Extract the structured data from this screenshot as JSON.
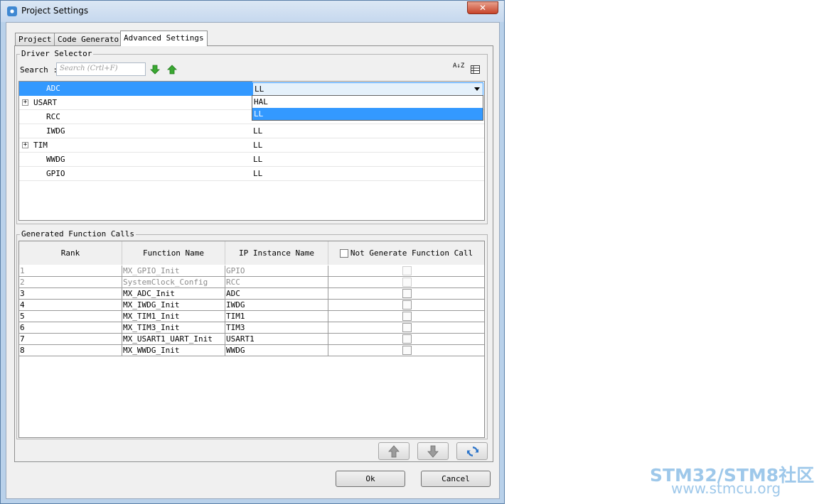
{
  "window": {
    "title": "Project Settings",
    "close_label": "✕"
  },
  "tabs": [
    {
      "label": "Project",
      "active": false
    },
    {
      "label": "Code Generator",
      "active": false
    },
    {
      "label": "Advanced Settings",
      "active": true
    }
  ],
  "driver_selector": {
    "legend": "Driver Selector",
    "search_label": "Search :",
    "search_placeholder": "Search (Crtl+F)",
    "rows": [
      {
        "name": "ADC",
        "value": "LL",
        "expandable": false,
        "selected": true
      },
      {
        "name": "USART",
        "value": "",
        "expandable": true,
        "selected": false
      },
      {
        "name": "RCC",
        "value": "",
        "expandable": false,
        "selected": false
      },
      {
        "name": "IWDG",
        "value": "LL",
        "expandable": false,
        "selected": false
      },
      {
        "name": "TIM",
        "value": "LL",
        "expandable": true,
        "selected": false
      },
      {
        "name": "WWDG",
        "value": "LL",
        "expandable": false,
        "selected": false
      },
      {
        "name": "GPIO",
        "value": "LL",
        "expandable": false,
        "selected": false
      }
    ],
    "dropdown_options": [
      "HAL",
      "LL"
    ],
    "dropdown_selected": "LL",
    "expand_glyph": "+",
    "sort_glyph": "A↓Z"
  },
  "function_calls": {
    "legend": "Generated Function Calls",
    "columns": [
      "Rank",
      "Function Name",
      "IP Instance Name",
      "Not Generate Function Call"
    ],
    "rows": [
      {
        "rank": "1",
        "function": "MX_GPIO_Init",
        "instance": "GPIO",
        "disabled": true
      },
      {
        "rank": "2",
        "function": "SystemClock_Config",
        "instance": "RCC",
        "disabled": true
      },
      {
        "rank": "3",
        "function": "MX_ADC_Init",
        "instance": "ADC",
        "disabled": false
      },
      {
        "rank": "4",
        "function": "MX_IWDG_Init",
        "instance": "IWDG",
        "disabled": false
      },
      {
        "rank": "5",
        "function": "MX_TIM1_Init",
        "instance": "TIM1",
        "disabled": false
      },
      {
        "rank": "6",
        "function": "MX_TIM3_Init",
        "instance": "TIM3",
        "disabled": false
      },
      {
        "rank": "7",
        "function": "MX_USART1_UART_Init",
        "instance": "USART1",
        "disabled": false
      },
      {
        "rank": "8",
        "function": "MX_WWDG_Init",
        "instance": "WWDG",
        "disabled": false
      }
    ]
  },
  "buttons": {
    "ok": "Ok",
    "cancel": "Cancel"
  },
  "watermark": {
    "line1": "STM32/STM8社区",
    "line2": "www.stmcu.org"
  },
  "colors": {
    "selection": "#3399ff",
    "green_arrow": "#3aa832",
    "refresh_blue": "#2a73c9"
  }
}
